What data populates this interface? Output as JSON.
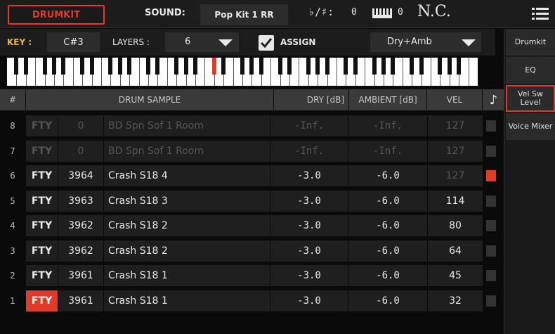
{
  "topbar": {
    "drumkit_label": "DRUMKIT",
    "sound_label": "SOUND:",
    "sound_value": "Pop Kit 1 RR",
    "keysig_label": "♭/♯:",
    "keysig_value": "0",
    "kbd_value": "0",
    "chord": "N.C."
  },
  "controls": {
    "key_label": "KEY :",
    "key_value": "C#3",
    "layers_label": "LAYERS :",
    "layers_value": "6",
    "assign_label": "ASSIGN",
    "mix_value": "Dry+Amb"
  },
  "table": {
    "headers": {
      "index": "#",
      "sample": "DRUM SAMPLE",
      "dry": "DRY  [dB]",
      "ambient": "AMBIENT [dB]",
      "vel": "VEL",
      "note_icon": "♪"
    },
    "rows": [
      {
        "idx": "8",
        "bank": "FTY",
        "num": "0",
        "name": "BD Spn Sof 1 Room",
        "dry": "-Inf.",
        "amb": "-Inf.",
        "vel": "127",
        "dim": true,
        "led": false,
        "bank_active": false
      },
      {
        "idx": "7",
        "bank": "FTY",
        "num": "0",
        "name": "BD Spn Sof 1 Room",
        "dry": "-Inf.",
        "amb": "-Inf.",
        "vel": "127",
        "dim": true,
        "led": false,
        "bank_active": false
      },
      {
        "idx": "6",
        "bank": "FTY",
        "num": "3964",
        "name": "Crash S18 4",
        "dry": "-3.0",
        "amb": "-6.0",
        "vel": "127",
        "dim": false,
        "vel_dim": true,
        "led": true,
        "bank_active": false
      },
      {
        "idx": "5",
        "bank": "FTY",
        "num": "3963",
        "name": "Crash S18 3",
        "dry": "-3.0",
        "amb": "-6.0",
        "vel": "114",
        "dim": false,
        "led": false,
        "bank_active": false
      },
      {
        "idx": "4",
        "bank": "FTY",
        "num": "3962",
        "name": "Crash S18 2",
        "dry": "-3.0",
        "amb": "-6.0",
        "vel": "80",
        "dim": false,
        "led": false,
        "bank_active": false
      },
      {
        "idx": "3",
        "bank": "FTY",
        "num": "3962",
        "name": "Crash S18 2",
        "dry": "-3.0",
        "amb": "-6.0",
        "vel": "64",
        "dim": false,
        "led": false,
        "bank_active": false
      },
      {
        "idx": "2",
        "bank": "FTY",
        "num": "3961",
        "name": "Crash S18 1",
        "dry": "-3.0",
        "amb": "-6.0",
        "vel": "45",
        "dim": false,
        "led": false,
        "bank_active": false
      },
      {
        "idx": "1",
        "bank": "FTY",
        "num": "3961",
        "name": "Crash S18 1",
        "dry": "-3.0",
        "amb": "-6.0",
        "vel": "32",
        "dim": false,
        "led": false,
        "bank_active": true
      }
    ]
  },
  "sidebar": {
    "tabs": [
      {
        "label": "Drumkit",
        "active": false
      },
      {
        "label": "EQ",
        "active": false
      },
      {
        "label": "Vel Sw Level",
        "active": true
      },
      {
        "label": "Voice Mixer",
        "active": false
      }
    ]
  },
  "colors": {
    "accent": "#e23a2a",
    "key_label": "#e8b53a"
  }
}
